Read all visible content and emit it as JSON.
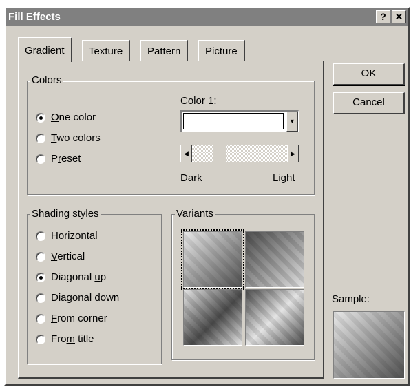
{
  "window": {
    "title": "Fill Effects",
    "help_label": "?",
    "close_label": "✕"
  },
  "tabs": [
    {
      "label": "Gradient",
      "active": true
    },
    {
      "label": "Texture",
      "active": false
    },
    {
      "label": "Pattern",
      "active": false
    },
    {
      "label": "Picture",
      "active": false
    }
  ],
  "colors_group": {
    "legend": "Colors",
    "options": [
      {
        "pre": "",
        "ul": "O",
        "post": "ne color",
        "checked": true
      },
      {
        "pre": "",
        "ul": "T",
        "post": "wo colors",
        "checked": false
      },
      {
        "pre": "P",
        "ul": "r",
        "post": "eset",
        "checked": false
      }
    ],
    "color_label_pre": "Color ",
    "color_label_ul": "1",
    "color_label_post": ":",
    "color_value": "",
    "dark_label_pre": "Dar",
    "dark_label_ul": "k",
    "light_label": "Light",
    "shade_value": 0.25
  },
  "shading_group": {
    "legend": "Shading styles",
    "options": [
      {
        "pre": "Hori",
        "ul": "z",
        "post": "ontal",
        "checked": false
      },
      {
        "pre": "",
        "ul": "V",
        "post": "ertical",
        "checked": false
      },
      {
        "pre": "Diagonal ",
        "ul": "u",
        "post": "p",
        "checked": true
      },
      {
        "pre": "Diagonal ",
        "ul": "d",
        "post": "own",
        "checked": false
      },
      {
        "pre": "",
        "ul": "F",
        "post": "rom corner",
        "checked": false
      },
      {
        "pre": "Fro",
        "ul": "m",
        "post": " title",
        "checked": false
      }
    ]
  },
  "variants_group": {
    "legend_pre": "Variant",
    "legend_ul": "s",
    "selected_index": 0
  },
  "buttons": {
    "ok": "OK",
    "cancel": "Cancel"
  },
  "sample_label": "Sample:"
}
